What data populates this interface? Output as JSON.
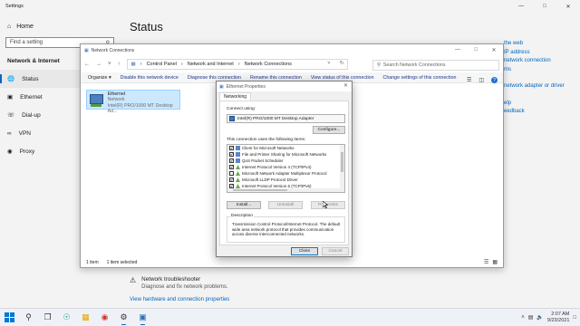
{
  "settings": {
    "title": "Settings",
    "home": "Home",
    "search_placeholder": "Find a setting",
    "section": "Network & Internet",
    "nav": [
      {
        "label": "Status",
        "icon": "globe-icon"
      },
      {
        "label": "Ethernet",
        "icon": "ethernet-icon"
      },
      {
        "label": "Dial-up",
        "icon": "phone-icon"
      },
      {
        "label": "VPN",
        "icon": "vpn-icon"
      },
      {
        "label": "Proxy",
        "icon": "proxy-icon"
      }
    ],
    "page_title": "Status",
    "related": [
      "the web",
      "IP address",
      "network connection",
      "ms",
      "network adapter or driver",
      "elp",
      "eedback"
    ],
    "troubleshooter_title": "Network troubleshooter",
    "troubleshooter_desc": "Diagnose and fix network problems.",
    "hw_link": "View hardware and connection properties"
  },
  "netconn": {
    "title": "Network Connections",
    "breadcrumb": [
      "Control Panel",
      "Network and Internet",
      "Network Connections"
    ],
    "search_placeholder": "Search Network Connections",
    "commands": [
      "Organize ▾",
      "Disable this network device",
      "Diagnose this connection",
      "Rename this connection",
      "View status of this connection",
      "Change settings of this connection"
    ],
    "item": {
      "name": "Ethernet",
      "status": "Network",
      "device": "Intel(R) PRO/1000 MT Desktop Ad..."
    },
    "status_count": "1 item",
    "status_selected": "1 item selected"
  },
  "dialog": {
    "title": "Ethernet Properties",
    "tab": "Networking",
    "connect_using": "Connect using:",
    "adapter": "Intel(R) PRO/1000 MT Desktop Adapter",
    "configure": "Configure...",
    "uses_items": "This connection uses the following items:",
    "items": [
      {
        "label": "Client for Microsoft Networks",
        "checked": "✔",
        "type": "net"
      },
      {
        "label": "File and Printer Sharing for Microsoft Networks",
        "checked": "✔",
        "type": "net"
      },
      {
        "label": "QoS Packet Scheduler",
        "checked": "✔",
        "type": "net"
      },
      {
        "label": "Internet Protocol Version 4 (TCP/IPv4)",
        "checked": "✔",
        "type": "proto"
      },
      {
        "label": "Microsoft Network Adapter Multiplexor Protocol",
        "checked": "",
        "type": "proto"
      },
      {
        "label": "Microsoft LLDP Protocol Driver",
        "checked": "✔",
        "type": "proto"
      },
      {
        "label": "Internet Protocol Version 6 (TCP/IPv6)",
        "checked": "✔",
        "type": "proto"
      }
    ],
    "install": "Install...",
    "uninstall": "Uninstall",
    "properties": "Properties",
    "description_caption": "Description",
    "description": "Transmission Control Protocol/Internet Protocol. The default wide area network protocol that provides communication across diverse interconnected networks.",
    "close": "Close",
    "cancel": "Cancel"
  },
  "taskbar": {
    "time": "2:07 AM",
    "date": "9/23/2021"
  },
  "colors": {
    "accent": "#0067c0",
    "selection": "#cce8ff"
  }
}
